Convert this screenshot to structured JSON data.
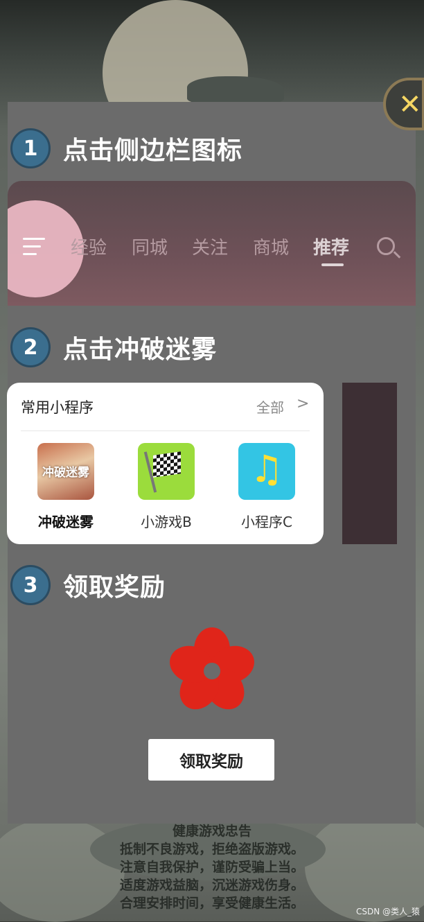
{
  "steps": [
    {
      "number": "1",
      "text": "点击侧边栏图标"
    },
    {
      "number": "2",
      "text": "点击冲破迷雾"
    },
    {
      "number": "3",
      "text": "领取奖励"
    }
  ],
  "nav": {
    "tabs": [
      "经验",
      "同城",
      "关注",
      "商城",
      "推荐"
    ],
    "active_tab": "推荐"
  },
  "mini_programs": {
    "title": "常用小程序",
    "all_label": "全部",
    "chevron": ">",
    "apps": [
      {
        "name": "冲破迷雾",
        "tile_text": "冲破迷雾",
        "icon": "game-icon"
      },
      {
        "name": "小游戏B",
        "icon": "checkered-flag-icon"
      },
      {
        "name": "小程序C",
        "icon": "music-note-icon"
      }
    ]
  },
  "reward_icon": "red-flower-icon",
  "claim_button": "领取奖励",
  "close_icon": "close-icon",
  "health_notice": {
    "title": "健康游戏忠告",
    "lines": [
      "抵制不良游戏，拒绝盗版游戏。",
      "注意自我保护，谨防受骗上当。",
      "适度游戏益脑，沉迷游戏伤身。",
      "合理安排时间，享受健康生活。"
    ]
  },
  "watermark": "CSDN @类人_猿",
  "colors": {
    "step_circle": "#3b6e8e",
    "flower": "#e0251a",
    "music_tile": "#33c5e4",
    "flag_tile": "#9bdc3c"
  }
}
